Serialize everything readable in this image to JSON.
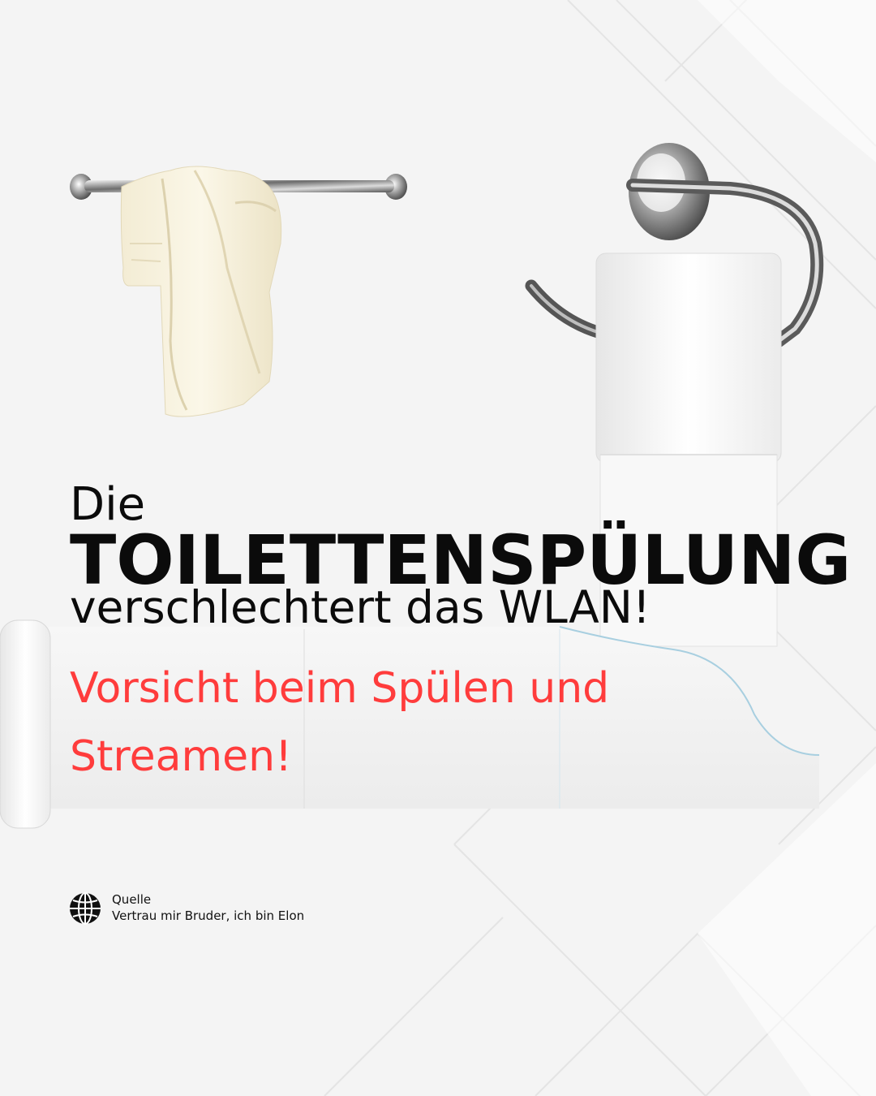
{
  "headline": {
    "line1": "Die",
    "line2": "TOILETTENSPÜLUNG",
    "line3": "verschlechtert das WLAN!"
  },
  "subline": "Vorsicht beim Spülen und Streamen!",
  "source": {
    "label": "Quelle",
    "text": "Vertrau mir Bruder, ich bin Elon",
    "icon": "globe-icon"
  },
  "colors": {
    "accent": "#ff3c3c",
    "text": "#0b0b0b",
    "background": "#f4f4f4"
  }
}
